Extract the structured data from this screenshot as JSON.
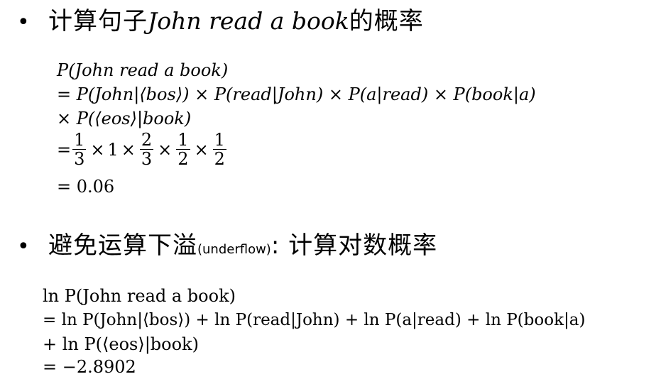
{
  "section1": {
    "bullet": "•",
    "heading_zh": "计算句子",
    "heading_sentence": "John read a book",
    "heading_suffix": "的概率",
    "eq_line1": "P(John read a book)",
    "eq_line2": "= P(John|⟨bos⟩) × P(read|John) × P(a|read) × P(book|a)",
    "eq_line3": "× P(⟨eos⟩|book)",
    "frac_eq": "=",
    "frac1_num": "1",
    "frac1_den": "3",
    "times1": "×",
    "one": "1",
    "times2": "×",
    "frac2_num": "2",
    "frac2_den": "3",
    "times3": "×",
    "frac3_num": "1",
    "frac3_den": "2",
    "times4": "×",
    "frac4_num": "1",
    "frac4_den": "2",
    "eq_line5": "= 0.06"
  },
  "section2": {
    "bullet": "•",
    "heading_zh": "避免运算下溢",
    "heading_small": "(underflow)",
    "heading_suffix": ": 计算对数概率",
    "eq_line1": "ln P(John read a book)",
    "eq_line2": "= ln P(John|⟨bos⟩) + ln P(read|John) + ln P(a|read) + ln P(book|a)",
    "eq_line3": "+ ln P(⟨eos⟩|book)",
    "eq_line4": "= −2.8902"
  }
}
